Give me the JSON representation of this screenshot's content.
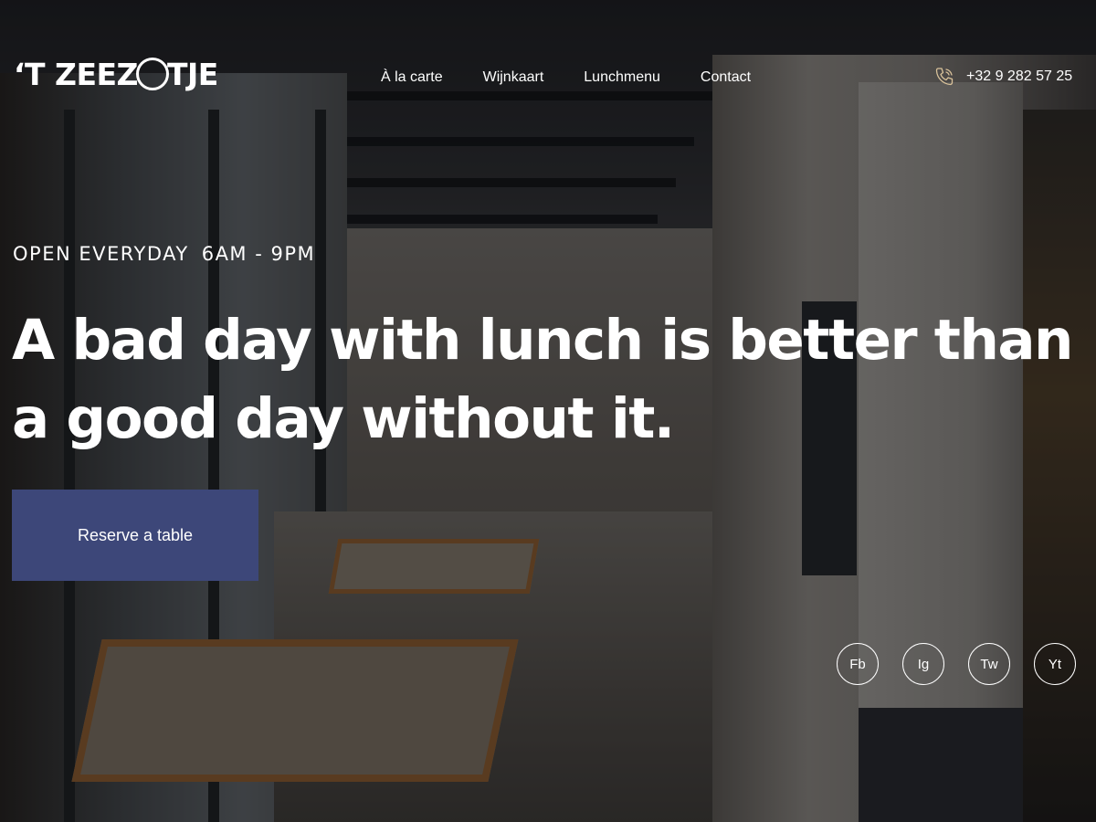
{
  "brand": {
    "logo_text_1": "‘T ZEEZ",
    "logo_text_2": "TJE"
  },
  "nav": [
    {
      "label": "À la carte"
    },
    {
      "label": "Wijnkaart"
    },
    {
      "label": "Lunchmenu"
    },
    {
      "label": "Contact"
    }
  ],
  "contact": {
    "phone": "+32 9 282 57 25",
    "icon": "phone-icon"
  },
  "hero": {
    "open_label": "OPEN EVERYDAY",
    "hours": "6AM - 9PM",
    "headline": "A bad day with lunch is better than a good day without it.",
    "cta_label": "Reserve a table"
  },
  "socials": [
    {
      "label": "Fb"
    },
    {
      "label": "Ig"
    },
    {
      "label": "Tw"
    },
    {
      "label": "Yt"
    }
  ],
  "colors": {
    "cta_background": "#3d4779",
    "text": "#ffffff",
    "phone_icon": "#d9c29a"
  }
}
